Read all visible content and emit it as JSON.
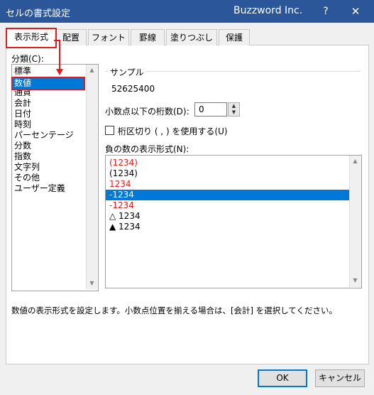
{
  "window": {
    "title": "セルの書式設定",
    "app_title": "Buzzword Inc.",
    "help_label": "?",
    "close_label": "✕"
  },
  "tabs": [
    {
      "label": "表示形式",
      "selected": true
    },
    {
      "label": "配置"
    },
    {
      "label": "フォント"
    },
    {
      "label": "罫線"
    },
    {
      "label": "塗りつぶし"
    },
    {
      "label": "保護"
    }
  ],
  "category": {
    "label": "分類(C):",
    "items": [
      "標準",
      "数値",
      "通貨",
      "会計",
      "日付",
      "時刻",
      "パーセンテージ",
      "分数",
      "指数",
      "文字列",
      "その他",
      "ユーザー定義"
    ],
    "selected_index": 1
  },
  "sample": {
    "label": "サンプル",
    "value": "52625400"
  },
  "decimal": {
    "label": "小数点以下の桁数(D):",
    "value": "0"
  },
  "thousands": {
    "label": "桁区切り ( , ) を使用する(U)",
    "checked": false
  },
  "negative": {
    "label": "負の数の表示形式(N):",
    "items": [
      {
        "text": "(1234)",
        "color": "#e11b1b"
      },
      {
        "text": "(1234)",
        "color": "#000000"
      },
      {
        "text": "1234",
        "color": "#e11b1b"
      },
      {
        "text": "-1234",
        "color": "#ffffff",
        "selected": true
      },
      {
        "text": "-1234",
        "color": "#e11b1b"
      },
      {
        "text": "△ 1234",
        "color": "#000000"
      },
      {
        "text": "▲ 1234",
        "color": "#000000"
      }
    ]
  },
  "description": "数値の表示形式を設定します。小数点位置を揃える場合は、[会計] を選択してください。",
  "buttons": {
    "ok": "OK",
    "cancel": "キャンセル"
  },
  "colors": {
    "titlebar": "#2b579a",
    "selection": "#0078d7",
    "highlight_border": "#e11b1b"
  }
}
